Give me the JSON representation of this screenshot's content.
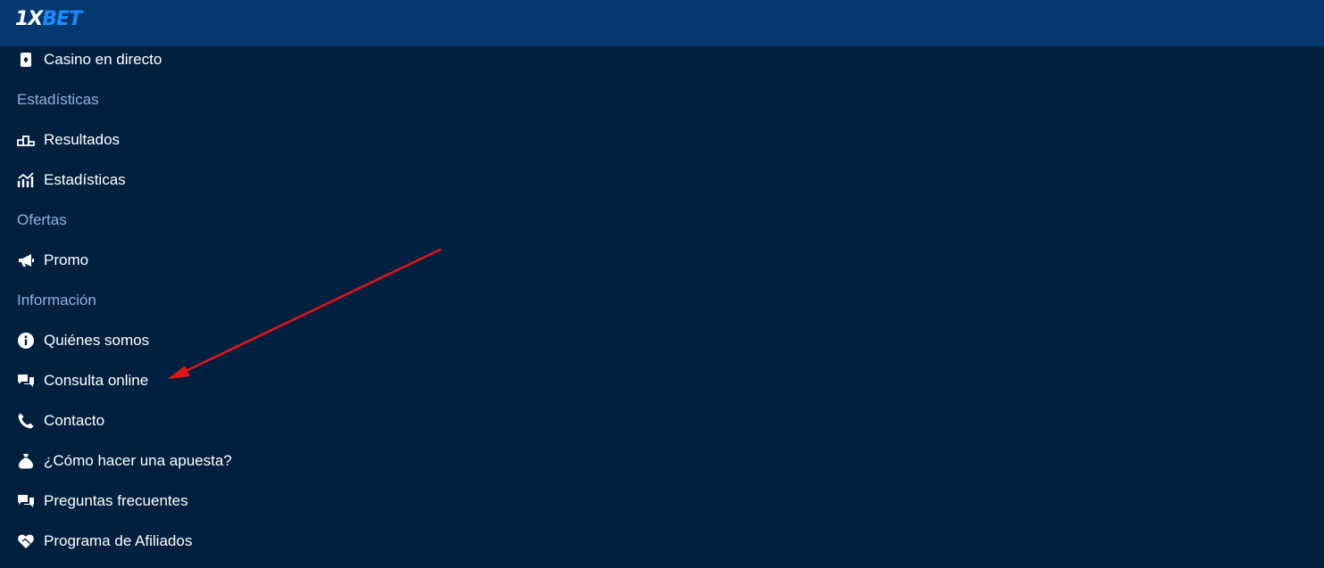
{
  "header": {
    "logo_part1": "1X",
    "logo_part2": "BET",
    "colors": {
      "bar": "#04386e",
      "accent": "#1a8cff"
    }
  },
  "menu": {
    "casino_live": {
      "label": "Casino en directo",
      "icon": "casino-card-icon"
    },
    "section_stats": "Estadísticas",
    "results": {
      "label": "Resultados",
      "icon": "podium-icon"
    },
    "statistics": {
      "label": "Estadísticas",
      "icon": "stats-chart-icon"
    },
    "section_offers": "Ofertas",
    "promo": {
      "label": "Promo",
      "icon": "megaphone-icon"
    },
    "section_info": "Información",
    "about": {
      "label": "Quiénes somos",
      "icon": "info-circle-icon"
    },
    "online_consult": {
      "label": "Consulta online",
      "icon": "chat-bubbles-icon"
    },
    "contact": {
      "label": "Contacto",
      "icon": "phone-icon"
    },
    "how_to_bet": {
      "label": "¿Cómo hacer una apuesta?",
      "icon": "money-bag-icon"
    },
    "faq": {
      "label": "Preguntas frecuentes",
      "icon": "chat-bubbles-icon"
    },
    "affiliates": {
      "label": "Programa de Afiliados",
      "icon": "handshake-heart-icon"
    }
  },
  "colors": {
    "background": "#01203f",
    "section_text": "#8fb1d6",
    "item_text": "#ffffff",
    "annotation_arrow": "#e0141b"
  }
}
